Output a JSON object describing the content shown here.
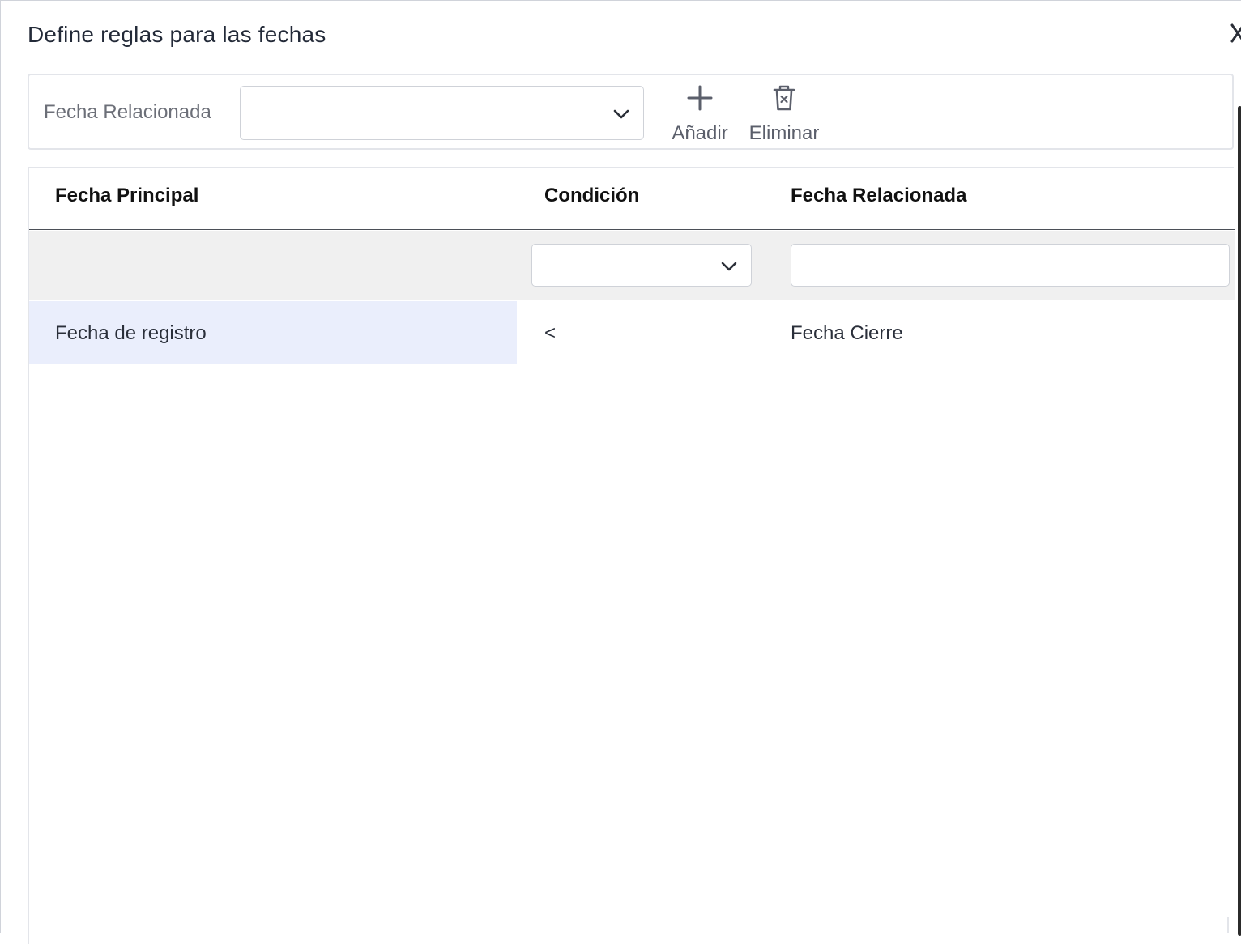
{
  "dialog": {
    "title": "Define reglas para las fechas"
  },
  "toolbar": {
    "related_date_label": "Fecha Relacionada",
    "related_date_value": "",
    "add_label": "Añadir",
    "delete_label": "Eliminar"
  },
  "grid": {
    "columns": [
      "Fecha Principal",
      "Condición",
      "Fecha Relacionada"
    ],
    "filter": {
      "condition_value": "",
      "related_value": ""
    },
    "rows": [
      {
        "principal": "Fecha de registro",
        "condicion": "<",
        "relacionada": "Fecha Cierre"
      }
    ]
  },
  "icons": {
    "close": "close-icon",
    "add": "plus-icon",
    "delete": "trash-icon",
    "dropdown": "chevron-down-icon"
  },
  "colors": {
    "selected_cell": "#eaeefc",
    "filter_row": "#f0f0f0",
    "icon": "#5b5f6b"
  }
}
